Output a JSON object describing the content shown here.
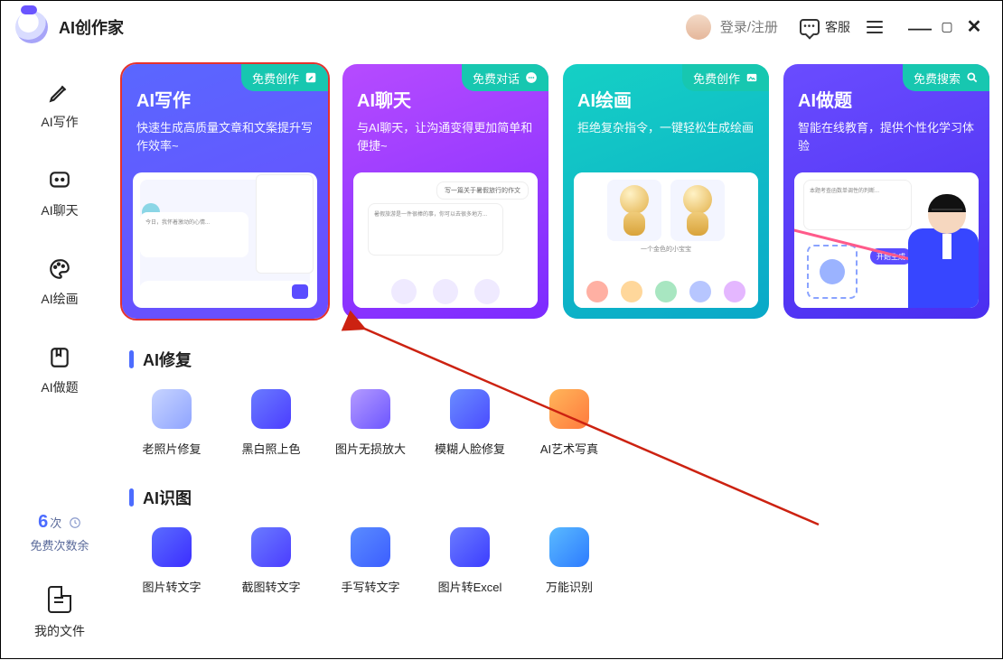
{
  "app": {
    "title": "AI创作家"
  },
  "header": {
    "login": "登录/注册",
    "service": "客服"
  },
  "sidebar": {
    "items": [
      {
        "label": "AI写作"
      },
      {
        "label": "AI聊天"
      },
      {
        "label": "AI绘画"
      },
      {
        "label": "AI做题"
      }
    ],
    "count_num": "6",
    "count_unit": "次",
    "count_sub": "免费次数余",
    "files": "我的文件"
  },
  "cards": [
    {
      "title": "AI写作",
      "desc": "快速生成高质量文章和文案提升写作效率~",
      "badge": "免费创作"
    },
    {
      "title": "AI聊天",
      "desc": "与AI聊天，让沟通变得更加简单和便捷~",
      "badge": "免费对话"
    },
    {
      "title": "AI绘画",
      "desc": "拒绝复杂指令，一键轻松生成绘画",
      "badge": "免费创作"
    },
    {
      "title": "AI做题",
      "desc": "智能在线教育，提供个性化学习体验",
      "badge": "免费搜索"
    }
  ],
  "card_detail": {
    "hw_btn": "开始生成"
  },
  "sections": {
    "repair": {
      "title": "AI修复",
      "tools": [
        {
          "label": "老照片修复"
        },
        {
          "label": "黑白照上色"
        },
        {
          "label": "图片无损放大"
        },
        {
          "label": "模糊人脸修复"
        },
        {
          "label": "AI艺术写真"
        }
      ]
    },
    "ocr": {
      "title": "AI识图",
      "tools": [
        {
          "label": "图片转文字"
        },
        {
          "label": "截图转文字"
        },
        {
          "label": "手写转文字"
        },
        {
          "label": "图片转Excel"
        },
        {
          "label": "万能识别"
        }
      ]
    }
  }
}
